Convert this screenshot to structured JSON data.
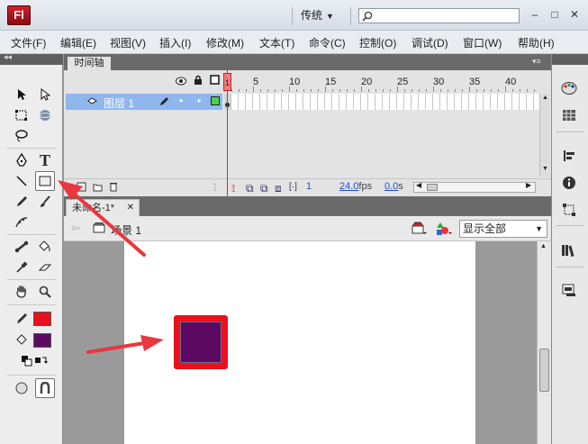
{
  "app": {
    "logo": "Fl",
    "workspace": "传统",
    "search_placeholder": "",
    "colors": {
      "accent": "#e8111d",
      "fill": "#5c0a61",
      "layer_selected": "#8fb7ee"
    }
  },
  "window_controls": [
    "–",
    "□",
    "✕"
  ],
  "menu": [
    "文件(F)",
    "编辑(E)",
    "视图(V)",
    "插入(I)",
    "修改(M)",
    "文本(T)",
    "命令(C)",
    "控制(O)",
    "调试(D)",
    "窗口(W)",
    "帮助(H)"
  ],
  "timeline": {
    "tab_label": "时间轴",
    "ruler": [
      "1",
      "5",
      "10",
      "15",
      "20",
      "25",
      "30",
      "35",
      "40"
    ],
    "layer_name": "图层 1",
    "current_frame": "1",
    "fps": "24.0",
    "fps_unit": "fps",
    "time": "0.0",
    "time_unit": "s",
    "playhead": "1"
  },
  "document": {
    "tab_label": "未命名-1*",
    "close": "✕",
    "scene_label": "场景 1",
    "zoom_value": "显示全部"
  },
  "tools": {
    "stroke_color": "#e8111d",
    "fill_color": "#5c0a61",
    "text_tool_glyph": "T"
  },
  "panel_collapse": "◂◂"
}
